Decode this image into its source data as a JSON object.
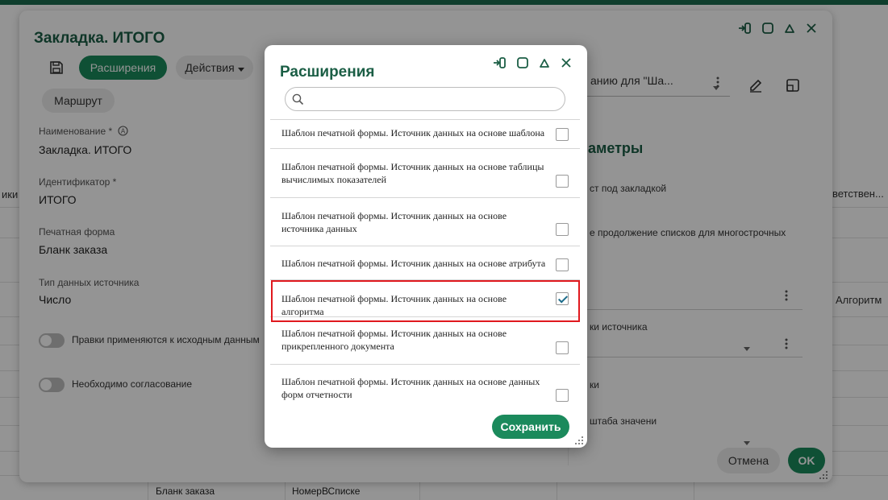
{
  "background": {
    "left_fragments": [
      "ики"
    ],
    "right_fragments": [
      "ветствен...",
      "Алгоритм"
    ],
    "table_cells": [
      "Бланк заказа",
      "НомерВСписке"
    ]
  },
  "main_dialog": {
    "title": "Закладка. ИТОГО",
    "toolbar": {
      "extensions_label": "Расширения",
      "actions_label": "Действия",
      "route_label": "Маршрут",
      "dropdown_text": "анию для \"Ша..."
    },
    "fields": [
      {
        "label": "Наименование *",
        "value": "Закладка. ИТОГО"
      },
      {
        "label": "Идентификатор *",
        "value": "ИТОГО"
      },
      {
        "label": "Печатная форма",
        "value": "Бланк заказа"
      },
      {
        "label": "Тип данных источника",
        "value": "Число"
      }
    ],
    "toggles": [
      {
        "label": "Правки применяются к исходным данным",
        "on": false
      },
      {
        "label": "Необходимо согласование",
        "on": false
      }
    ],
    "right_panel": {
      "title": "аметры",
      "text1": "ст под закладкой",
      "text2": "е продолжение списков для многострочных",
      "text3": "ки источника",
      "text4": "ки",
      "text5": "штаба значени"
    },
    "cancel_label": "Отмена",
    "ok_label": "OK"
  },
  "extensions_modal": {
    "title": "Расширения",
    "search": {
      "placeholder": "",
      "value": ""
    },
    "items": [
      {
        "text": "Шаблон печатной формы. Источник данных на основе шаблона",
        "checked": false
      },
      {
        "text": "Шаблон печатной формы. Источник данных на основе таблицы вычислимых показателей",
        "checked": false
      },
      {
        "text": "Шаблон печатной формы. Источник данных на основе источника данных",
        "checked": false
      },
      {
        "text": "Шаблон печатной формы. Источник данных на основе атрибута",
        "checked": false
      },
      {
        "text": "Шаблон печатной формы. Источник данных на основе алгоритма",
        "checked": true
      },
      {
        "text": "Шаблон печатной формы. Источник данных на основе прикрепленного документа",
        "checked": false
      },
      {
        "text": "Шаблон печатной формы. Источник данных на основе данных форм отчетности",
        "checked": false
      }
    ],
    "save_label": "Сохранить"
  },
  "colors": {
    "accent": "#1b8a5c",
    "title": "#1b5e45",
    "highlight": "#e0191e"
  }
}
